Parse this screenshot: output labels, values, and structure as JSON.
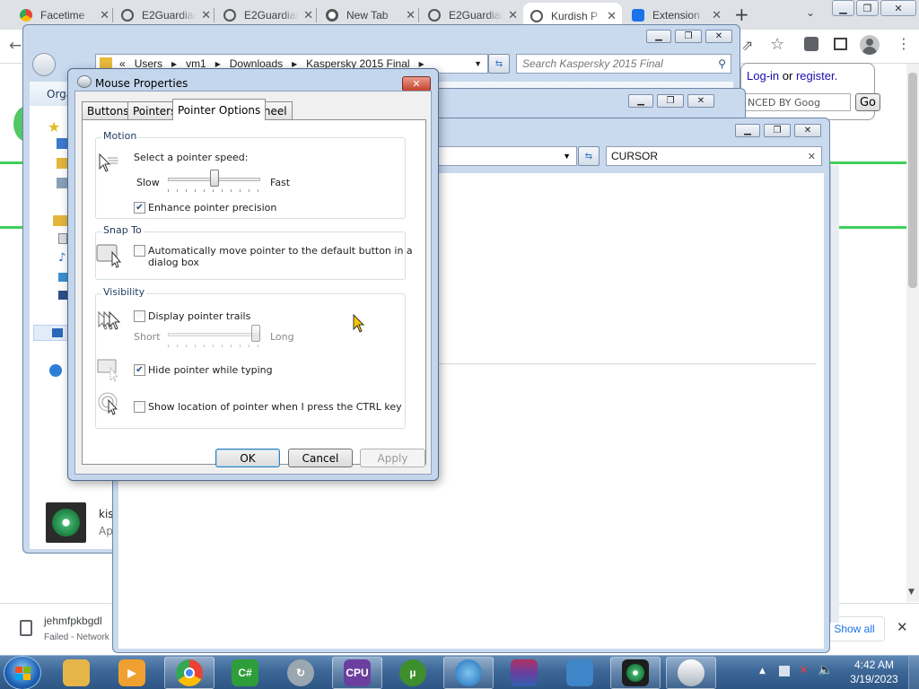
{
  "chrome": {
    "tabs": [
      {
        "title": "Facetime",
        "icon": "chrome-web-icon"
      },
      {
        "title": "E2Guardian",
        "icon": "globe-icon"
      },
      {
        "title": "E2Guardian",
        "icon": "globe-icon"
      },
      {
        "title": "New Tab",
        "icon": "chrome-icon"
      },
      {
        "title": "E2Guardian",
        "icon": "globe-icon"
      },
      {
        "title": "Kurdish P",
        "icon": "globe-icon"
      },
      {
        "title": "Extension",
        "icon": "puzzle-icon"
      }
    ],
    "new_tab_label": "+",
    "page_links": {
      "login": "Log-in",
      "or": "or",
      "register": "register."
    },
    "search_placeholder": "NCED BY Goog",
    "go_label": "Go",
    "download": {
      "filename": "jehmfpkbgdl",
      "status": "Failed - Network",
      "show_all": "Show all"
    }
  },
  "explorer_back": {
    "breadcrumb": [
      "Users",
      "vm1",
      "Downloads",
      "Kaspersky 2015 Final"
    ],
    "search_placeholder": "Search Kaspersky 2015 Final",
    "organize": "Orga",
    "file_name": "kis",
    "file_type": "Ap"
  },
  "explorer_front": {
    "search_value": "CURSOR"
  },
  "dialog": {
    "title": "Mouse Properties",
    "tabs": [
      "Buttons",
      "Pointers",
      "Pointer Options",
      "Wheel"
    ],
    "active_tab": 2,
    "motion": {
      "title": "Motion",
      "speed_label": "Select a pointer speed:",
      "slow": "Slow",
      "fast": "Fast",
      "speed_level": 0.5,
      "enhance_label": "Enhance pointer precision",
      "enhance_checked": true
    },
    "snap": {
      "title": "Snap To",
      "label_line1": "Automatically move pointer to the default button in a",
      "label_line2": "dialog box",
      "checked": false
    },
    "visibility": {
      "title": "Visibility",
      "trails_label": "Display pointer trails",
      "trails_checked": false,
      "short": "Short",
      "long": "Long",
      "trail_level": 1.0,
      "hide_label": "Hide pointer while typing",
      "hide_checked": true,
      "ctrl_label": "Show location of pointer when I press the CTRL key",
      "ctrl_checked": false
    },
    "buttons": {
      "ok": "OK",
      "cancel": "Cancel",
      "apply": "Apply"
    }
  },
  "taskbar": {
    "time": "4:42 AM",
    "date": "3/19/2023",
    "apps": [
      "explorer",
      "media-player",
      "chrome",
      "csharp",
      "arrow-app",
      "cpu-z",
      "utorrent",
      "network-globe",
      "winrar",
      "control-panel",
      "kaspersky",
      "mouse"
    ]
  },
  "colors": {
    "taskbar": "#3c6797",
    "chrome_tabstrip": "#dee1e6",
    "dialog_frame": "#c4d6ec",
    "cursor": "#f5c400"
  }
}
